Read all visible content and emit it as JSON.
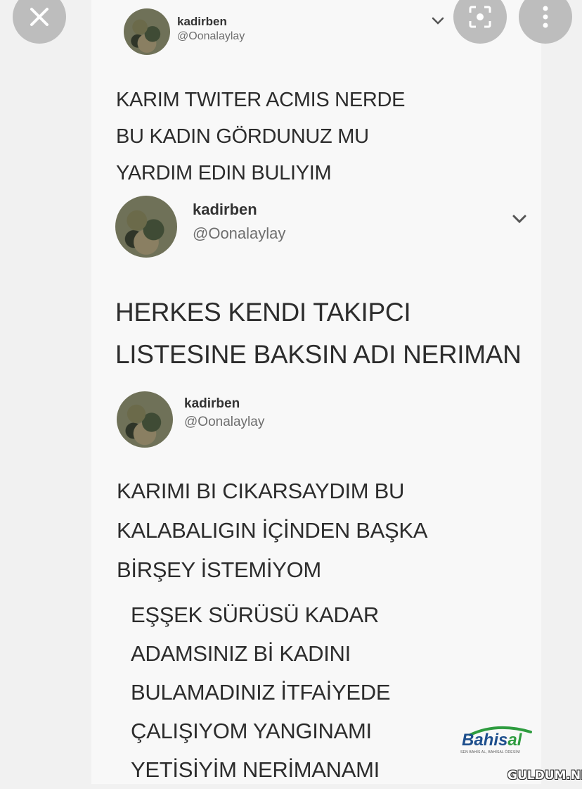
{
  "tweets": [
    {
      "display_name": "kadirben",
      "handle": "@Oonalaylay",
      "lines": [
        "KARIM TWITER ACMIS NERDE",
        "BU KADIN GÖRDUNUZ MU",
        "YARDIM EDIN BULIYIM"
      ]
    },
    {
      "display_name": "kadirben",
      "handle": "@Oonalaylay",
      "lines": [
        "HERKES KENDI TAKIPCI",
        "LISTESINE BAKSIN ADI NERIMAN"
      ]
    },
    {
      "display_name": "kadirben",
      "handle": "@Oonalaylay",
      "lines": [
        "KARIMI BI CIKARSAYDIM BU",
        "KALABALIGIN İÇİNDEN BAŞKA",
        "BİRŞEY İSTEMİYOM"
      ]
    }
  ],
  "reply": {
    "lines": [
      "EŞŞEK SÜRÜSÜ KADAR",
      "ADAMSINIZ Bİ KADINI",
      "BULAMADINIZ İTFAİYEDE",
      "ÇALIŞIYOM YANGINAMI",
      "YETİSİYİM NERİMANAMI"
    ]
  },
  "logo": {
    "word_main": "Bahis",
    "word_accent": "al",
    "tagline": "SEN BAHİS AL, BAHİSAL ÖDESİN!"
  },
  "watermark": "GULDUM.NET",
  "icons": {
    "close": "close-icon",
    "lens": "lens-search-icon",
    "more": "more-vertical-icon",
    "chevron": "chevron-down-icon"
  }
}
